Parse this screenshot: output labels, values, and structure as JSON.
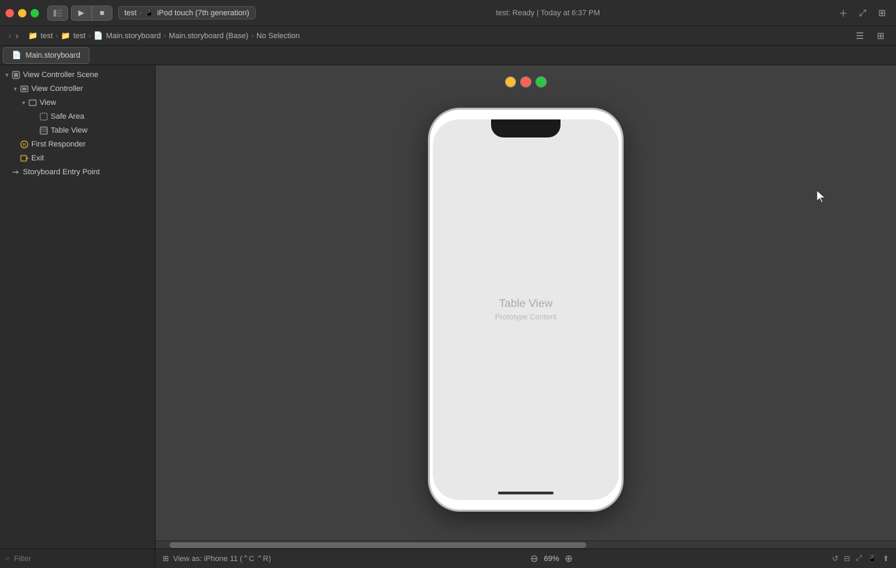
{
  "titlebar": {
    "traffic_lights": [
      "red",
      "yellow",
      "green"
    ],
    "window_controls": [
      "sidebar",
      "play",
      "stop"
    ],
    "device_label": "test",
    "device_icon": "📱",
    "device_name": "iPod touch (7th generation)",
    "status": "test: Ready | Today at 6:37 PM",
    "nav_up_btn": "⊞",
    "nav_down_btn": "⊟"
  },
  "breadcrumb": {
    "items": [
      "test",
      "test",
      "Main.storyboard",
      "Main.storyboard (Base)",
      "No Selection"
    ]
  },
  "tab": {
    "icon": "📄",
    "label": "Main.storyboard"
  },
  "sidebar": {
    "title": "View Controller Scene",
    "tree": [
      {
        "label": "View Controller Scene",
        "indent": 0,
        "disclosure": "▾",
        "icon": "🎬",
        "type": "scene"
      },
      {
        "label": "View Controller",
        "indent": 1,
        "disclosure": "▾",
        "icon": "☐",
        "type": "controller"
      },
      {
        "label": "View",
        "indent": 2,
        "disclosure": "▾",
        "icon": "☐",
        "type": "view"
      },
      {
        "label": "Safe Area",
        "indent": 3,
        "disclosure": "",
        "icon": "☐",
        "type": "safe-area"
      },
      {
        "label": "Table View",
        "indent": 3,
        "disclosure": "",
        "icon": "☐",
        "type": "table-view"
      },
      {
        "label": "First Responder",
        "indent": 1,
        "disclosure": "",
        "icon": "⚡",
        "type": "responder"
      },
      {
        "label": "Exit",
        "indent": 1,
        "disclosure": "",
        "icon": "⎋",
        "type": "exit"
      },
      {
        "label": "Storyboard Entry Point",
        "indent": 0,
        "disclosure": "",
        "icon": "→",
        "type": "entry-point"
      }
    ],
    "filter_placeholder": "Filter"
  },
  "canvas": {
    "phone": {
      "table_view_label": "Table View",
      "prototype_label": "Prototype Content"
    },
    "entry_arrow": "→",
    "zoom_level": "69%",
    "view_as_label": "View as: iPhone 11 (⌃C ⌃R)"
  },
  "toolbar_right": {
    "icons": [
      "☰",
      "⊞"
    ]
  }
}
